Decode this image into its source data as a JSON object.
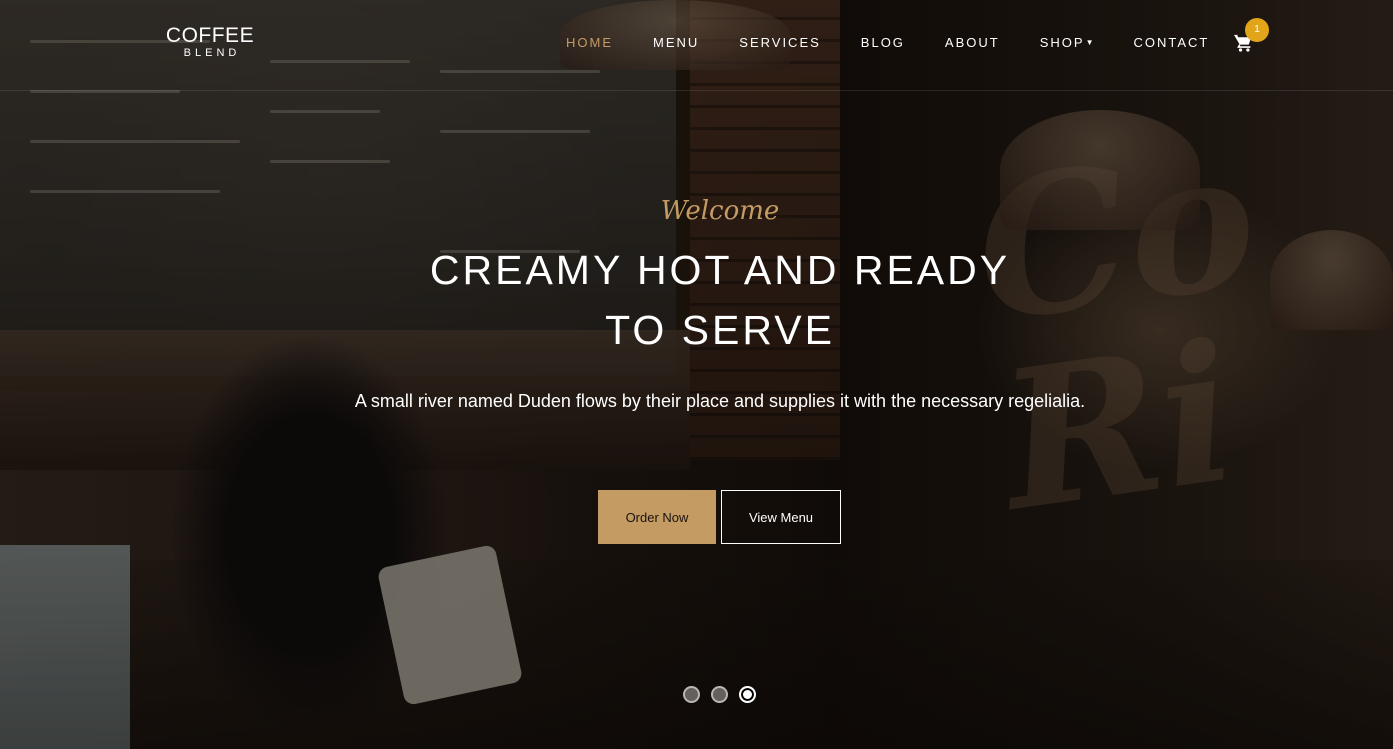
{
  "brand": {
    "top": "COFFEE",
    "bottom": "BLEND"
  },
  "nav": {
    "items": [
      {
        "label": "HOME",
        "active": true
      },
      {
        "label": "MENU"
      },
      {
        "label": "SERVICES"
      },
      {
        "label": "BLOG"
      },
      {
        "label": "ABOUT"
      },
      {
        "label": "SHOP",
        "dropdown": true
      },
      {
        "label": "CONTACT"
      }
    ],
    "cart_icon": "cart-icon",
    "cart_count": "1"
  },
  "hero": {
    "welcome": "Welcome",
    "headline": "CREAMY HOT AND READY TO SERVE",
    "subtitle": "A small river named Duden flows by their place and supplies it with the necessary regelialia.",
    "order_button": "Order Now",
    "menu_button": "View Menu"
  },
  "carousel": {
    "slides": 3,
    "active_index": 2
  },
  "colors": {
    "accent": "#c49b63",
    "badge": "#e2a51a"
  }
}
